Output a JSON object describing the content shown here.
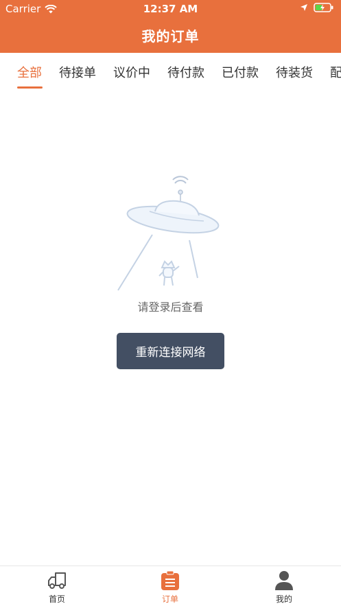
{
  "status_bar": {
    "carrier": "Carrier",
    "time": "12:37 AM"
  },
  "header": {
    "title": "我的订单"
  },
  "tabs": [
    {
      "label": "全部",
      "active": true
    },
    {
      "label": "待接单"
    },
    {
      "label": "议价中"
    },
    {
      "label": "待付款"
    },
    {
      "label": "已付款"
    },
    {
      "label": "待装货"
    },
    {
      "label": "配"
    }
  ],
  "empty_state": {
    "message": "请登录后查看",
    "button_label": "重新连接网络",
    "illustration": "ufo-icon"
  },
  "tabbar": [
    {
      "label": "首页",
      "icon": "truck-icon"
    },
    {
      "label": "订单",
      "icon": "order-list-icon",
      "active": true
    },
    {
      "label": "我的",
      "icon": "user-icon"
    }
  ],
  "colors": {
    "accent": "#E8703D",
    "button_bg": "#434F63",
    "text": "#333333"
  }
}
